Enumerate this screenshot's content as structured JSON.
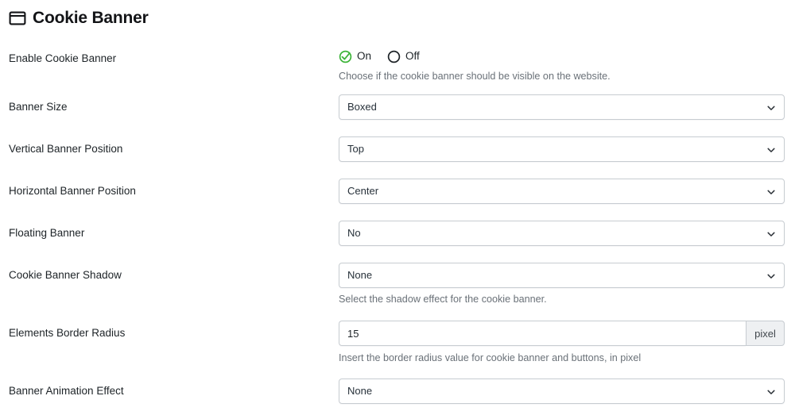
{
  "section": {
    "icon": "browser-window-icon",
    "title": "Cookie Banner"
  },
  "rows": [
    {
      "id": "enable-cookie-banner",
      "label": "Enable Cookie Banner",
      "type": "radio",
      "options": [
        {
          "label": "On",
          "value": "on",
          "selected": true,
          "icon": "check-circle-icon"
        },
        {
          "label": "Off",
          "value": "off",
          "selected": false,
          "icon": "circle-icon"
        }
      ],
      "help": "Choose if the cookie banner should be visible on the website."
    },
    {
      "id": "banner-size",
      "label": "Banner Size",
      "type": "select",
      "value": "Boxed",
      "icon": "chevron-down-icon",
      "help": ""
    },
    {
      "id": "vertical-banner-position",
      "label": "Vertical Banner Position",
      "type": "select",
      "value": "Top",
      "icon": "chevron-down-icon",
      "help": ""
    },
    {
      "id": "horizontal-banner-position",
      "label": "Horizontal Banner Position",
      "type": "select",
      "value": "Center",
      "icon": "chevron-down-icon",
      "help": ""
    },
    {
      "id": "floating-banner",
      "label": "Floating Banner",
      "type": "select",
      "value": "No",
      "icon": "chevron-down-icon",
      "help": ""
    },
    {
      "id": "cookie-banner-shadow",
      "label": "Cookie Banner Shadow",
      "type": "select",
      "value": "None",
      "icon": "chevron-down-icon",
      "help": "Select the shadow effect for the cookie banner."
    },
    {
      "id": "elements-border-radius",
      "label": "Elements Border Radius",
      "type": "input",
      "value": "15",
      "placeholder": "",
      "addon": "pixel",
      "help": "Insert the border radius value for cookie banner and buttons, in pixel"
    },
    {
      "id": "banner-animation-effect",
      "label": "Banner Animation Effect",
      "type": "select",
      "value": "None",
      "icon": "chevron-down-icon",
      "help": ""
    }
  ],
  "colors": {
    "accent_on": "#3db439",
    "radio_off": "#1d2327",
    "border": "#c7ccd1",
    "help_text": "#6a7178",
    "addon_bg": "#eef0f2",
    "page_bg": "#ffffff"
  }
}
